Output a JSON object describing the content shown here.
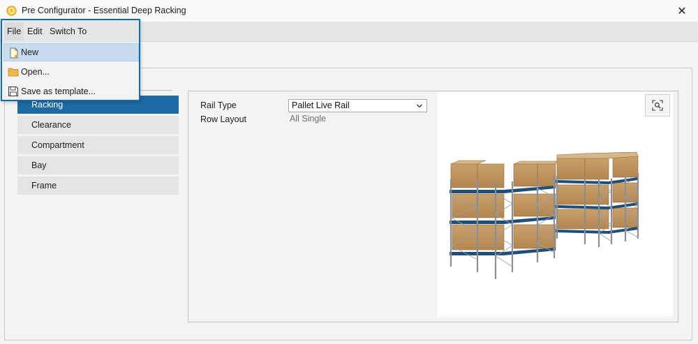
{
  "window": {
    "title": "Pre Configurator - Essential Deep Racking",
    "close_glyph": "✕",
    "app_icon": "app-logo-icon"
  },
  "menubar": {
    "items": [
      "File",
      "Edit",
      "Switch To"
    ],
    "open_menu": "File"
  },
  "file_menu": {
    "items": [
      {
        "label": "New",
        "icon": "new-document-icon"
      },
      {
        "label": "Open...",
        "icon": "folder-icon"
      },
      {
        "label": "Save as template...",
        "icon": "save-icon"
      }
    ],
    "highlighted": "New"
  },
  "nav": {
    "items": [
      "Racking",
      "Clearance",
      "Compartment",
      "Bay",
      "Frame"
    ],
    "selected": "Racking"
  },
  "properties": {
    "rail_type_label": "Rail Type",
    "rail_type_value": "Pallet Live Rail",
    "row_layout_label": "Row Layout",
    "row_layout_value": "All Single"
  },
  "preview": {
    "zoom_icon": "zoom-fit-icon"
  },
  "colors": {
    "accent": "#1e6aa4",
    "menu_border": "#1369b5",
    "hover": "#c7dcef",
    "rack_beam": "#1f4e78",
    "box": "#c49a62"
  }
}
